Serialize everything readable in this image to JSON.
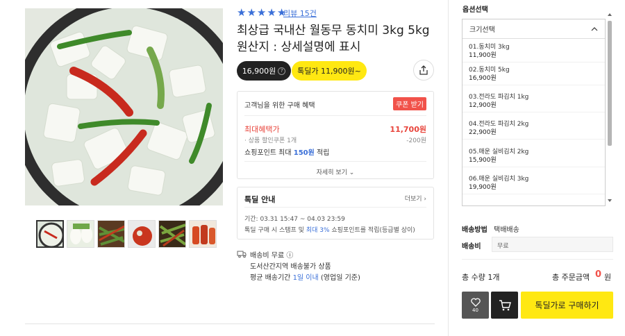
{
  "product": {
    "rating_stars": 5,
    "review_link": "리뷰 15건",
    "title_line1": "최상급 국내산 월동무 동치미 3kg 5kg",
    "title_line2": "원산지 : 상세설명에 표시",
    "price": "16,900원",
    "deal_price": "톡딜가 11,900원~"
  },
  "benefits": {
    "title": "고객님을 위한 구매 혜택",
    "coupon_button": "쿠폰 받기",
    "max_label": "최대혜택가",
    "max_price": "11,700원",
    "sub_label": "· 상품 할인쿠폰 1개",
    "sub_amount": "-200원",
    "point_prefix": "쇼핑포인트 최대 ",
    "point_value": "150원",
    "point_suffix": " 적립",
    "more": "자세히 보기 ⌄"
  },
  "deal_info": {
    "title": "톡딜 안내",
    "more": "더보기 ›",
    "period": "기간: 03.31 15:47 ~ 04.03 23:59",
    "note_prefix": "톡딜 구매 시 스탬프 및 ",
    "note_highlight": "최대 3%",
    "note_suffix": " 쇼핑포인트를 적립(등급별 상이)"
  },
  "shipping": {
    "fee_line": "배송비 무료 ⓘ",
    "area_line": "도서산간지역 배송불가 상품",
    "period_prefix": "평균 배송기간 ",
    "period_highlight": "1일 이내",
    "period_suffix": " (영업일 기준)"
  },
  "options": {
    "heading": "옵션선택",
    "dropdown_label": "크기선택",
    "items": [
      {
        "name": "01.동치미 3kg",
        "price": "11,900원"
      },
      {
        "name": "02.동치미 5kg",
        "price": "16,900원"
      },
      {
        "name": "03.전라도 파김치 1kg",
        "price": "12,900원"
      },
      {
        "name": "04.전라도 파김치 2kg",
        "price": "22,900원"
      },
      {
        "name": "05.매운 실비김치 2kg",
        "price": "15,900원"
      },
      {
        "name": "06.매운 실비김치 3kg",
        "price": "19,900원"
      }
    ]
  },
  "order": {
    "ship_method_label": "배송방법",
    "ship_method_value": "택배배송",
    "ship_fee_label": "배송비",
    "ship_fee_value": "무료",
    "total_qty": "총 수량 1개",
    "total_amount_label": "총 주문금액",
    "total_amount": "0",
    "total_won": "원",
    "wish_count": "40",
    "buy_button": "톡딜가로 구매하기"
  },
  "colors": {
    "accent_yellow": "#ffe812",
    "accent_blue": "#3a6fd8",
    "accent_red": "#f1524a"
  }
}
